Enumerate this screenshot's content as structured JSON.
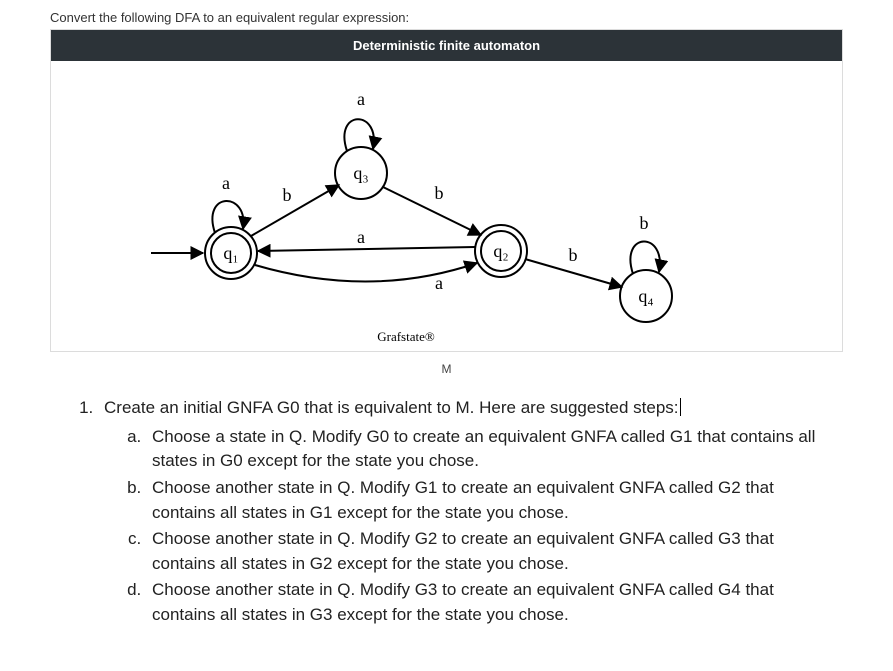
{
  "prompt": "Convert the following DFA to an equivalent regular expression:",
  "figure": {
    "header": "Deterministic finite automaton",
    "states": {
      "q1": "q₁",
      "q2": "q₂",
      "q3": "q₃",
      "q4": "q₄"
    },
    "edge_labels": {
      "q1_loop": "a",
      "q3_loop": "a",
      "q4_loop": "b",
      "q1_q3": "b",
      "q3_q2": "b",
      "q2_q1": "a",
      "q1_q2": "a",
      "q2_q4": "b"
    },
    "watermark": "Grafstate®",
    "caption": "M"
  },
  "steps": {
    "intro": "Create an initial GNFA G0 that is equivalent to M. Here are suggested steps:",
    "items": [
      "Choose a state in Q. Modify G0 to create an equivalent GNFA called G1 that contains all states in G0 except for the state you chose.",
      "Choose another state in Q. Modify G1 to create an equivalent GNFA called G2 that contains all states in G1 except for the state you chose.",
      "Choose another state in Q. Modify G2 to create an equivalent GNFA called G3 that contains all states in G2 except for the state you chose.",
      "Choose another state in Q. Modify G3 to create an equivalent GNFA called G4 that contains all states in G3 except for the state you chose."
    ]
  },
  "chart_data": {
    "type": "diagram",
    "automaton": {
      "states": [
        "q1",
        "q2",
        "q3",
        "q4"
      ],
      "start": "q1",
      "accept": [
        "q1",
        "q2"
      ],
      "transitions": [
        {
          "from": "q1",
          "to": "q1",
          "label": "a"
        },
        {
          "from": "q1",
          "to": "q3",
          "label": "b"
        },
        {
          "from": "q3",
          "to": "q3",
          "label": "a"
        },
        {
          "from": "q3",
          "to": "q2",
          "label": "b"
        },
        {
          "from": "q2",
          "to": "q1",
          "label": "a"
        },
        {
          "from": "q1",
          "to": "q2",
          "label": "a"
        },
        {
          "from": "q2",
          "to": "q4",
          "label": "b"
        },
        {
          "from": "q4",
          "to": "q4",
          "label": "b"
        }
      ]
    }
  }
}
